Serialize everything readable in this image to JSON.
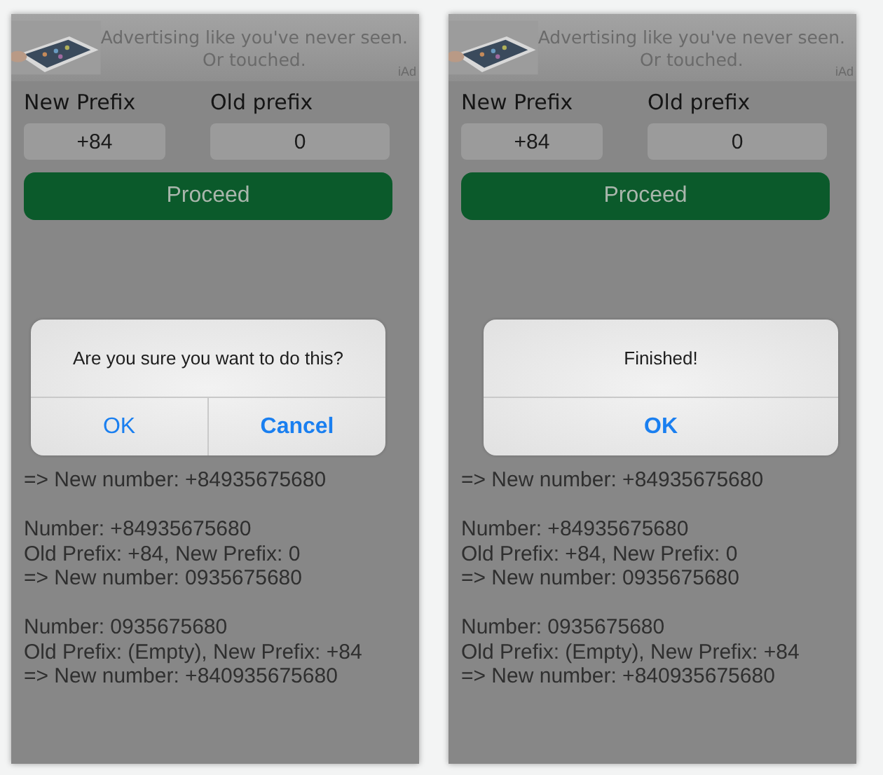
{
  "screens": [
    {
      "ad": {
        "headline": "Advertising like you've never seen.",
        "subline": "Or touched.",
        "badge": "iAd"
      },
      "new_prefix": {
        "label": "New Prefix",
        "value": "+84"
      },
      "old_prefix": {
        "label": "Old prefix",
        "value": "0"
      },
      "proceed": "Proceed",
      "output_blocks": [
        [
          "=> New number: +84935675680"
        ],
        [
          "Number: +84935675680",
          "Old Prefix: +84, New Prefix: 0",
          "=> New number: 0935675680"
        ],
        [
          "Number: 0935675680",
          "Old Prefix: (Empty), New Prefix: +84",
          "=> New number: +840935675680"
        ]
      ],
      "alert": {
        "message": "Are you sure you want to do this?",
        "buttons": [
          {
            "label": "OK",
            "bold": false
          },
          {
            "label": "Cancel",
            "bold": true
          }
        ]
      }
    },
    {
      "ad": {
        "headline": "Advertising like you've never seen.",
        "subline": "Or touched.",
        "badge": "iAd"
      },
      "new_prefix": {
        "label": "New Prefix",
        "value": "+84"
      },
      "old_prefix": {
        "label": "Old prefix",
        "value": "0"
      },
      "proceed": "Proceed",
      "output_blocks": [
        [
          "=> New number: +84935675680"
        ],
        [
          "Number: +84935675680",
          "Old Prefix: +84, New Prefix: 0",
          "=> New number: 0935675680"
        ],
        [
          "Number: 0935675680",
          "Old Prefix: (Empty), New Prefix: +84",
          "=> New number: +840935675680"
        ]
      ],
      "alert": {
        "message": "Finished!",
        "buttons": [
          {
            "label": "OK",
            "bold": true
          }
        ]
      }
    }
  ]
}
